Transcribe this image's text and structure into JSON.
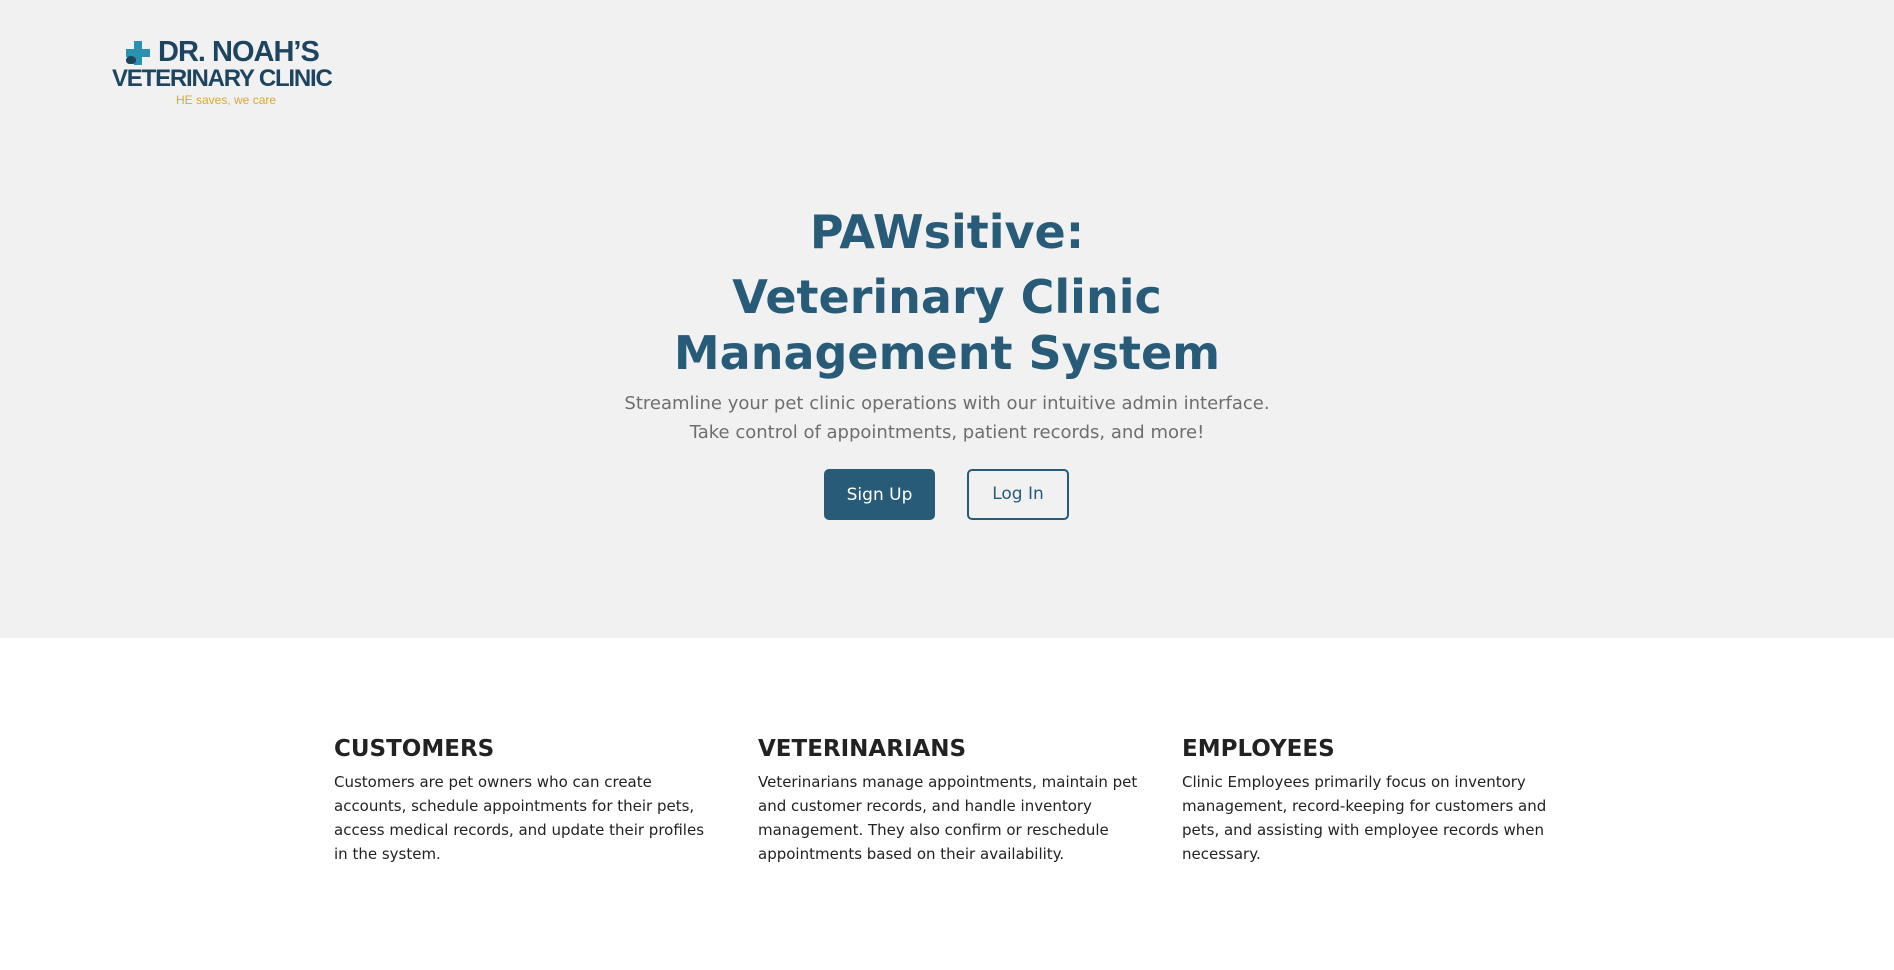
{
  "logo": {
    "line1": "DR. NOAH’S",
    "line2": "VETERINARY CLINIC",
    "tagline": "HE saves, we care",
    "icon": "medical-cross-paw-icon",
    "colors": {
      "primary": "#1d4560",
      "cross": "#2a92b0",
      "tagline": "#d9a73b"
    }
  },
  "hero": {
    "title_line1": "PAWsitive:",
    "title_line2": "Veterinary Clinic",
    "title_line3": "Management System",
    "subtitle_line1": "Streamline your pet clinic operations with our intuitive admin interface.",
    "subtitle_line2": "Take control of appointments, patient records, and more!",
    "signup_label": "Sign Up",
    "login_label": "Log In",
    "colors": {
      "title": "#275b78",
      "background": "#f1f1f1",
      "button": "#275b78"
    }
  },
  "roles": [
    {
      "title": "CUSTOMERS",
      "description": "Customers are pet owners who can create accounts, schedule appointments for their pets, access medical records, and update their profiles in the system."
    },
    {
      "title": "VETERINARIANS",
      "description": "Veterinarians manage appointments, maintain pet and customer records, and handle inventory management. They also confirm or reschedule appointments based on their availability."
    },
    {
      "title": "EMPLOYEES",
      "description": "Clinic Employees primarily focus on inventory management, record-keeping for customers and pets, and assisting with employee records when necessary."
    }
  ]
}
